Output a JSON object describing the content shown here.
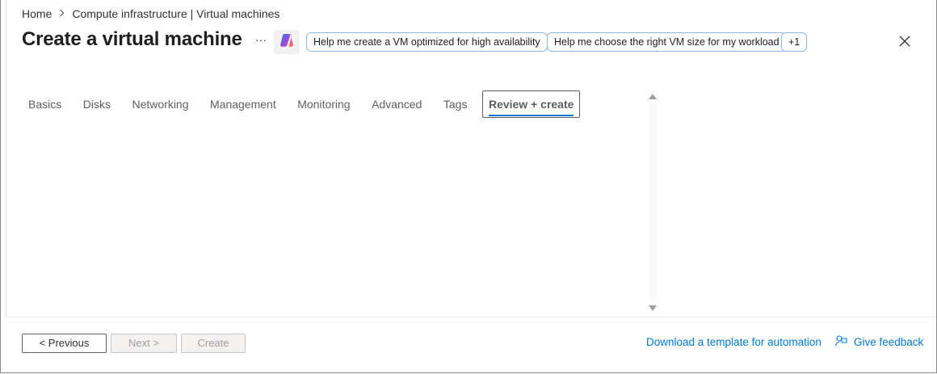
{
  "breadcrumb": {
    "items": [
      "Home",
      "Compute infrastructure | Virtual machines"
    ]
  },
  "header": {
    "title": "Create a virtual machine",
    "more_label": "···",
    "suggestions": [
      "Help me create a VM optimized for high availability",
      "Help me choose the right VM size for my workload",
      "+1"
    ]
  },
  "tabs": [
    {
      "label": "Basics"
    },
    {
      "label": "Disks"
    },
    {
      "label": "Networking"
    },
    {
      "label": "Management"
    },
    {
      "label": "Monitoring"
    },
    {
      "label": "Advanced"
    },
    {
      "label": "Tags"
    },
    {
      "label": "Review + create",
      "active": true
    }
  ],
  "footer": {
    "previous_label": "< Previous",
    "next_label": "Next >",
    "create_label": "Create",
    "download_link": "Download a template for automation",
    "feedback_link": "Give feedback"
  },
  "icons": {
    "copilot": "copilot-icon",
    "close": "close-icon",
    "chevron": "chevron-right-icon",
    "feedback": "feedback-icon"
  },
  "colors": {
    "accent": "#0078d4",
    "chip_border": "#8fb8e0",
    "disabled_text": "#a19f9d"
  }
}
